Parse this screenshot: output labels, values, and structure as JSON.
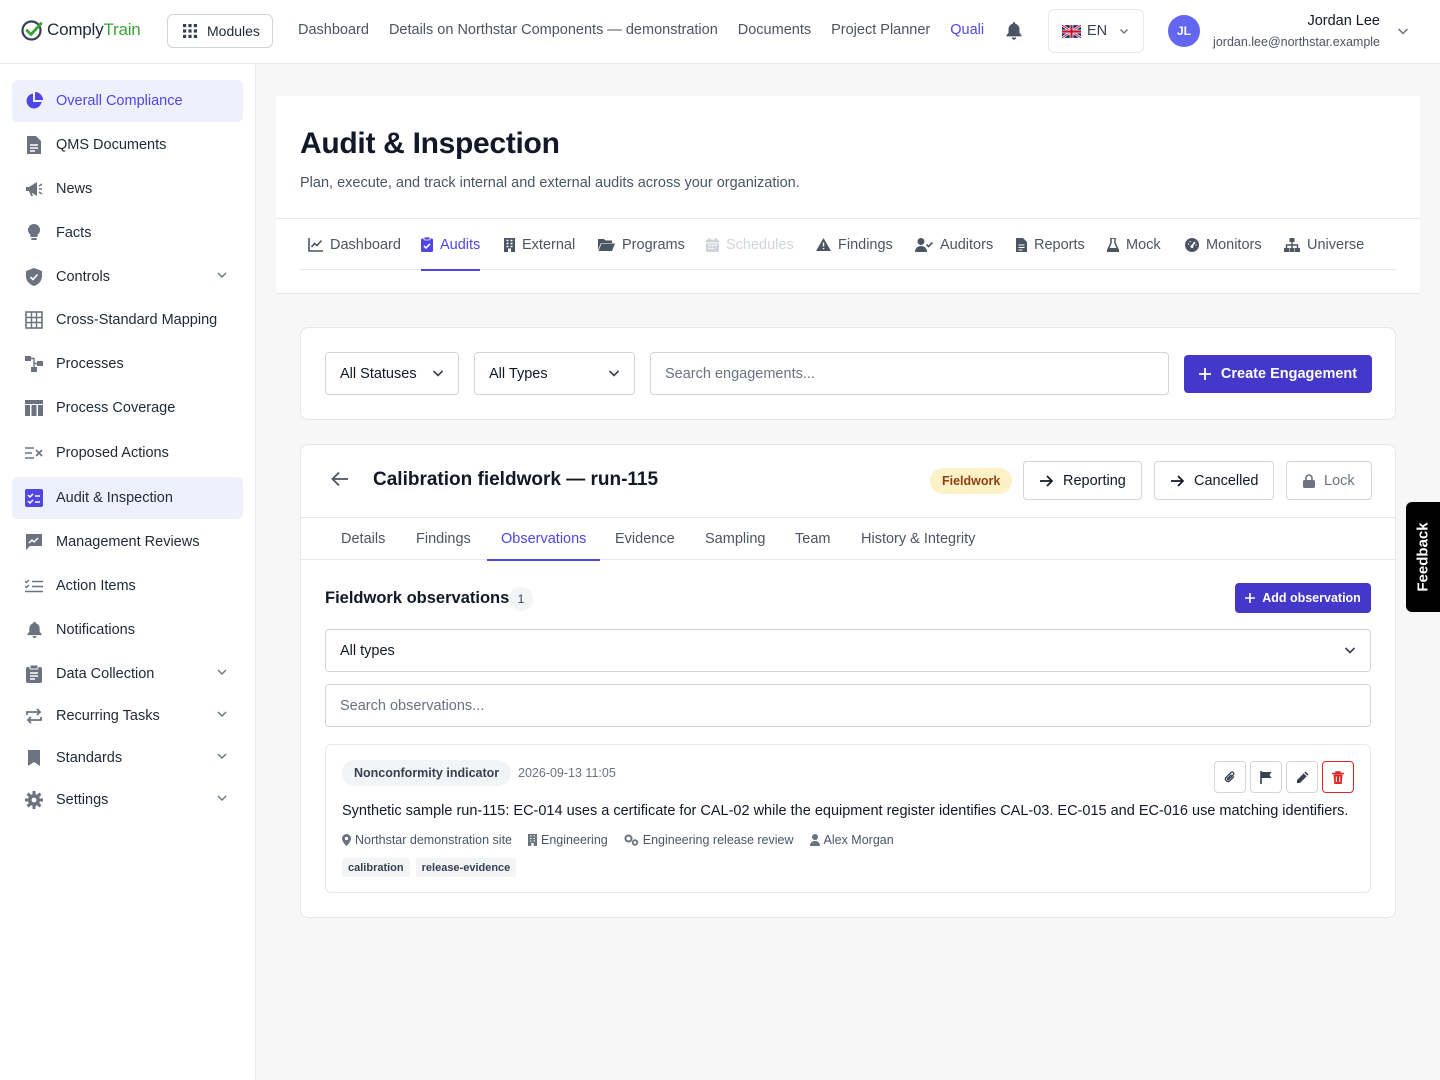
{
  "brand": {
    "name_part1": "Comply",
    "name_part2": "Train"
  },
  "topbar": {
    "modules_label": "Modules",
    "nav": [
      "Dashboard",
      "Details on Northstar Components — demonstration",
      "Documents",
      "Project Planner",
      "Quali"
    ],
    "active_nav": "Quali",
    "language": "EN",
    "user": {
      "initials": "JL",
      "name": "Jordan Lee",
      "email": "jordan.lee@northstar.example"
    }
  },
  "sidebar": {
    "items": [
      {
        "label": "Overall Compliance",
        "icon": "pie-chart-icon",
        "active": true
      },
      {
        "label": "QMS Documents",
        "icon": "document-icon"
      },
      {
        "label": "News",
        "icon": "megaphone-icon"
      },
      {
        "label": "Facts",
        "icon": "lightbulb-icon"
      },
      {
        "label": "Controls",
        "icon": "shield-icon",
        "expandable": true
      },
      {
        "label": "Cross-Standard Mapping",
        "icon": "grid-icon"
      },
      {
        "label": "Processes",
        "icon": "flow-icon"
      },
      {
        "label": "Process Coverage",
        "icon": "table-icon"
      },
      {
        "label": "Proposed Actions",
        "icon": "list-x-icon"
      },
      {
        "label": "Audit & Inspection",
        "icon": "clipboard-check-icon",
        "highlighted": true
      },
      {
        "label": "Management Reviews",
        "icon": "chart-review-icon"
      },
      {
        "label": "Action Items",
        "icon": "checklist-icon"
      },
      {
        "label": "Notifications",
        "icon": "bell-icon"
      },
      {
        "label": "Data Collection",
        "icon": "clipboard-icon",
        "expandable": true
      },
      {
        "label": "Recurring Tasks",
        "icon": "repeat-icon",
        "expandable": true
      },
      {
        "label": "Standards",
        "icon": "bookmark-icon",
        "expandable": true
      },
      {
        "label": "Settings",
        "icon": "gear-icon",
        "expandable": true
      }
    ]
  },
  "page": {
    "title": "Audit & Inspection",
    "subtitle": "Plan, execute, and track internal and external audits across your organization.",
    "tabs": [
      {
        "label": "Dashboard",
        "icon": "line-chart-icon"
      },
      {
        "label": "Audits",
        "icon": "clipboard-check-icon",
        "active": true
      },
      {
        "label": "External",
        "icon": "building-icon"
      },
      {
        "label": "Programs",
        "icon": "folder-open-icon"
      },
      {
        "label": "Schedules",
        "icon": "calendar-icon",
        "disabled": true
      },
      {
        "label": "Findings",
        "icon": "warning-icon"
      },
      {
        "label": "Auditors",
        "icon": "user-check-icon"
      },
      {
        "label": "Reports",
        "icon": "report-icon"
      },
      {
        "label": "Mock",
        "icon": "flask-icon"
      },
      {
        "label": "Monitors",
        "icon": "dashboard-gauge-icon"
      },
      {
        "label": "Universe",
        "icon": "hierarchy-icon"
      }
    ]
  },
  "filters": {
    "status_value": "All Statuses",
    "type_value": "All Types",
    "search_placeholder": "Search engagements...",
    "create_label": "Create Engagement"
  },
  "engagement": {
    "title": "Calibration fieldwork — run-115",
    "status_badge": "Fieldwork",
    "actions": {
      "reporting": "Reporting",
      "cancelled": "Cancelled",
      "lock": "Lock"
    },
    "tabs": [
      "Details",
      "Findings",
      "Observations",
      "Evidence",
      "Sampling",
      "Team",
      "History & Integrity"
    ],
    "active_tab": "Observations",
    "observations": {
      "heading": "Fieldwork observations",
      "count": "1",
      "add_label": "Add observation",
      "type_filter_value": "All types",
      "search_placeholder": "Search observations...",
      "items": [
        {
          "type": "Nonconformity indicator",
          "datetime": "2026-09-13 11:05",
          "text": "Synthetic sample run-115: EC-014 uses a certificate for CAL-02 while the equipment register identifies CAL-03. EC-015 and EC-016 use matching identifiers.",
          "site": "Northstar demonstration site",
          "department": "Engineering",
          "process": "Engineering release review",
          "person": "Alex Morgan",
          "tags": [
            "calibration",
            "release-evidence"
          ]
        }
      ]
    }
  },
  "feedback_label": "Feedback",
  "colors": {
    "accent": "#4f46e5",
    "primary_button": "#4338ca",
    "brand_green": "#3aa335",
    "danger": "#dc2626",
    "badge_fieldwork_bg": "#fdf1c7"
  }
}
